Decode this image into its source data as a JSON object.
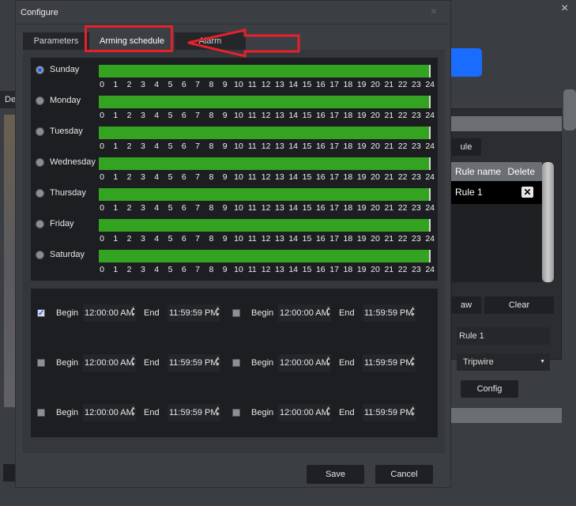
{
  "window": {
    "close": "×",
    "partial_tab": "De"
  },
  "background": {
    "add_rule_partial": "ule",
    "col_rule_name": "Rule name",
    "col_delete": "Delete",
    "rules": [
      {
        "name": "Rule 1"
      }
    ],
    "draw_partial": "aw",
    "clear": "Clear",
    "rule_name_value": "Rule 1",
    "rule_type": "Tripwire",
    "config": "Config"
  },
  "dialog": {
    "title": "Configure",
    "close": "×",
    "tabs": [
      {
        "label": "Parameters"
      },
      {
        "label": "Arming schedule",
        "active": true
      },
      {
        "label": "Alarm"
      }
    ],
    "days": [
      {
        "name": "Sunday",
        "selected": true,
        "armed_hours": [
          0,
          24
        ]
      },
      {
        "name": "Monday",
        "armed_hours": [
          0,
          24
        ]
      },
      {
        "name": "Tuesday",
        "armed_hours": [
          0,
          24
        ]
      },
      {
        "name": "Wednesday",
        "armed_hours": [
          0,
          24
        ]
      },
      {
        "name": "Thursday",
        "armed_hours": [
          0,
          24
        ]
      },
      {
        "name": "Friday",
        "armed_hours": [
          0,
          24
        ]
      },
      {
        "name": "Saturday",
        "armed_hours": [
          0,
          24
        ]
      }
    ],
    "hour_labels": [
      "0",
      "1",
      "2",
      "3",
      "4",
      "5",
      "6",
      "7",
      "8",
      "9",
      "10",
      "11",
      "12",
      "13",
      "14",
      "15",
      "16",
      "17",
      "18",
      "19",
      "20",
      "21",
      "22",
      "23",
      "24"
    ],
    "periods": [
      {
        "checked": true,
        "begin_label": "Begin",
        "begin": "12:00:00 AM",
        "end_label": "End",
        "end": "11:59:59 PM"
      },
      {
        "checked": false,
        "begin_label": "Begin",
        "begin": "12:00:00 AM",
        "end_label": "End",
        "end": "11:59:59 PM"
      },
      {
        "checked": false,
        "begin_label": "Begin",
        "begin": "12:00:00 AM",
        "end_label": "End",
        "end": "11:59:59 PM"
      },
      {
        "checked": false,
        "begin_label": "Begin",
        "begin": "12:00:00 AM",
        "end_label": "End",
        "end": "11:59:59 PM"
      },
      {
        "checked": false,
        "begin_label": "Begin",
        "begin": "12:00:00 AM",
        "end_label": "End",
        "end": "11:59:59 PM"
      },
      {
        "checked": false,
        "begin_label": "Begin",
        "begin": "12:00:00 AM",
        "end_label": "End",
        "end": "11:59:59 PM"
      }
    ],
    "save": "Save",
    "cancel": "Cancel"
  },
  "annotation": {
    "color": "#e8202a"
  },
  "colors": {
    "armed": "#33a321",
    "accent": "#1a5cff"
  }
}
